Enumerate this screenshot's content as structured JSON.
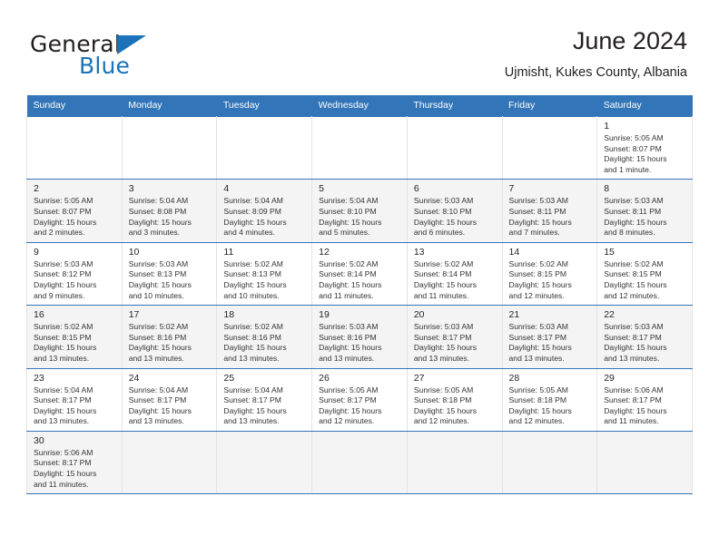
{
  "brand": {
    "name_part1": "General",
    "name_part2": "Blue",
    "flag_icon": "triangle-flag-icon"
  },
  "header": {
    "title": "June 2024",
    "subtitle": "Ujmisht, Kukes County, Albania"
  },
  "calendar": {
    "weekday_headers": [
      "Sunday",
      "Monday",
      "Tuesday",
      "Wednesday",
      "Thursday",
      "Friday",
      "Saturday"
    ],
    "accent_color": "#3275b9",
    "header_text_color": "#ffffff",
    "shaded_row_color": "#f4f4f4",
    "weeks": [
      {
        "shaded": false,
        "days": [
          {
            "day": "",
            "sunrise": "",
            "sunset": "",
            "daylight": "",
            "daylight2": "",
            "empty": true
          },
          {
            "day": "",
            "sunrise": "",
            "sunset": "",
            "daylight": "",
            "daylight2": "",
            "empty": true
          },
          {
            "day": "",
            "sunrise": "",
            "sunset": "",
            "daylight": "",
            "daylight2": "",
            "empty": true
          },
          {
            "day": "",
            "sunrise": "",
            "sunset": "",
            "daylight": "",
            "daylight2": "",
            "empty": true
          },
          {
            "day": "",
            "sunrise": "",
            "sunset": "",
            "daylight": "",
            "daylight2": "",
            "empty": true
          },
          {
            "day": "",
            "sunrise": "",
            "sunset": "",
            "daylight": "",
            "daylight2": "",
            "empty": true
          },
          {
            "day": "1",
            "sunrise": "Sunrise: 5:05 AM",
            "sunset": "Sunset: 8:07 PM",
            "daylight": "Daylight: 15 hours",
            "daylight2": "and 1 minute.",
            "empty": false
          }
        ]
      },
      {
        "shaded": true,
        "days": [
          {
            "day": "2",
            "sunrise": "Sunrise: 5:05 AM",
            "sunset": "Sunset: 8:07 PM",
            "daylight": "Daylight: 15 hours",
            "daylight2": "and 2 minutes.",
            "empty": false
          },
          {
            "day": "3",
            "sunrise": "Sunrise: 5:04 AM",
            "sunset": "Sunset: 8:08 PM",
            "daylight": "Daylight: 15 hours",
            "daylight2": "and 3 minutes.",
            "empty": false
          },
          {
            "day": "4",
            "sunrise": "Sunrise: 5:04 AM",
            "sunset": "Sunset: 8:09 PM",
            "daylight": "Daylight: 15 hours",
            "daylight2": "and 4 minutes.",
            "empty": false
          },
          {
            "day": "5",
            "sunrise": "Sunrise: 5:04 AM",
            "sunset": "Sunset: 8:10 PM",
            "daylight": "Daylight: 15 hours",
            "daylight2": "and 5 minutes.",
            "empty": false
          },
          {
            "day": "6",
            "sunrise": "Sunrise: 5:03 AM",
            "sunset": "Sunset: 8:10 PM",
            "daylight": "Daylight: 15 hours",
            "daylight2": "and 6 minutes.",
            "empty": false
          },
          {
            "day": "7",
            "sunrise": "Sunrise: 5:03 AM",
            "sunset": "Sunset: 8:11 PM",
            "daylight": "Daylight: 15 hours",
            "daylight2": "and 7 minutes.",
            "empty": false
          },
          {
            "day": "8",
            "sunrise": "Sunrise: 5:03 AM",
            "sunset": "Sunset: 8:11 PM",
            "daylight": "Daylight: 15 hours",
            "daylight2": "and 8 minutes.",
            "empty": false
          }
        ]
      },
      {
        "shaded": false,
        "days": [
          {
            "day": "9",
            "sunrise": "Sunrise: 5:03 AM",
            "sunset": "Sunset: 8:12 PM",
            "daylight": "Daylight: 15 hours",
            "daylight2": "and 9 minutes.",
            "empty": false
          },
          {
            "day": "10",
            "sunrise": "Sunrise: 5:03 AM",
            "sunset": "Sunset: 8:13 PM",
            "daylight": "Daylight: 15 hours",
            "daylight2": "and 10 minutes.",
            "empty": false
          },
          {
            "day": "11",
            "sunrise": "Sunrise: 5:02 AM",
            "sunset": "Sunset: 8:13 PM",
            "daylight": "Daylight: 15 hours",
            "daylight2": "and 10 minutes.",
            "empty": false
          },
          {
            "day": "12",
            "sunrise": "Sunrise: 5:02 AM",
            "sunset": "Sunset: 8:14 PM",
            "daylight": "Daylight: 15 hours",
            "daylight2": "and 11 minutes.",
            "empty": false
          },
          {
            "day": "13",
            "sunrise": "Sunrise: 5:02 AM",
            "sunset": "Sunset: 8:14 PM",
            "daylight": "Daylight: 15 hours",
            "daylight2": "and 11 minutes.",
            "empty": false
          },
          {
            "day": "14",
            "sunrise": "Sunrise: 5:02 AM",
            "sunset": "Sunset: 8:15 PM",
            "daylight": "Daylight: 15 hours",
            "daylight2": "and 12 minutes.",
            "empty": false
          },
          {
            "day": "15",
            "sunrise": "Sunrise: 5:02 AM",
            "sunset": "Sunset: 8:15 PM",
            "daylight": "Daylight: 15 hours",
            "daylight2": "and 12 minutes.",
            "empty": false
          }
        ]
      },
      {
        "shaded": true,
        "days": [
          {
            "day": "16",
            "sunrise": "Sunrise: 5:02 AM",
            "sunset": "Sunset: 8:15 PM",
            "daylight": "Daylight: 15 hours",
            "daylight2": "and 13 minutes.",
            "empty": false
          },
          {
            "day": "17",
            "sunrise": "Sunrise: 5:02 AM",
            "sunset": "Sunset: 8:16 PM",
            "daylight": "Daylight: 15 hours",
            "daylight2": "and 13 minutes.",
            "empty": false
          },
          {
            "day": "18",
            "sunrise": "Sunrise: 5:02 AM",
            "sunset": "Sunset: 8:16 PM",
            "daylight": "Daylight: 15 hours",
            "daylight2": "and 13 minutes.",
            "empty": false
          },
          {
            "day": "19",
            "sunrise": "Sunrise: 5:03 AM",
            "sunset": "Sunset: 8:16 PM",
            "daylight": "Daylight: 15 hours",
            "daylight2": "and 13 minutes.",
            "empty": false
          },
          {
            "day": "20",
            "sunrise": "Sunrise: 5:03 AM",
            "sunset": "Sunset: 8:17 PM",
            "daylight": "Daylight: 15 hours",
            "daylight2": "and 13 minutes.",
            "empty": false
          },
          {
            "day": "21",
            "sunrise": "Sunrise: 5:03 AM",
            "sunset": "Sunset: 8:17 PM",
            "daylight": "Daylight: 15 hours",
            "daylight2": "and 13 minutes.",
            "empty": false
          },
          {
            "day": "22",
            "sunrise": "Sunrise: 5:03 AM",
            "sunset": "Sunset: 8:17 PM",
            "daylight": "Daylight: 15 hours",
            "daylight2": "and 13 minutes.",
            "empty": false
          }
        ]
      },
      {
        "shaded": false,
        "days": [
          {
            "day": "23",
            "sunrise": "Sunrise: 5:04 AM",
            "sunset": "Sunset: 8:17 PM",
            "daylight": "Daylight: 15 hours",
            "daylight2": "and 13 minutes.",
            "empty": false
          },
          {
            "day": "24",
            "sunrise": "Sunrise: 5:04 AM",
            "sunset": "Sunset: 8:17 PM",
            "daylight": "Daylight: 15 hours",
            "daylight2": "and 13 minutes.",
            "empty": false
          },
          {
            "day": "25",
            "sunrise": "Sunrise: 5:04 AM",
            "sunset": "Sunset: 8:17 PM",
            "daylight": "Daylight: 15 hours",
            "daylight2": "and 13 minutes.",
            "empty": false
          },
          {
            "day": "26",
            "sunrise": "Sunrise: 5:05 AM",
            "sunset": "Sunset: 8:17 PM",
            "daylight": "Daylight: 15 hours",
            "daylight2": "and 12 minutes.",
            "empty": false
          },
          {
            "day": "27",
            "sunrise": "Sunrise: 5:05 AM",
            "sunset": "Sunset: 8:18 PM",
            "daylight": "Daylight: 15 hours",
            "daylight2": "and 12 minutes.",
            "empty": false
          },
          {
            "day": "28",
            "sunrise": "Sunrise: 5:05 AM",
            "sunset": "Sunset: 8:18 PM",
            "daylight": "Daylight: 15 hours",
            "daylight2": "and 12 minutes.",
            "empty": false
          },
          {
            "day": "29",
            "sunrise": "Sunrise: 5:06 AM",
            "sunset": "Sunset: 8:17 PM",
            "daylight": "Daylight: 15 hours",
            "daylight2": "and 11 minutes.",
            "empty": false
          }
        ]
      },
      {
        "shaded": true,
        "days": [
          {
            "day": "30",
            "sunrise": "Sunrise: 5:06 AM",
            "sunset": "Sunset: 8:17 PM",
            "daylight": "Daylight: 15 hours",
            "daylight2": "and 11 minutes.",
            "empty": false
          },
          {
            "day": "",
            "sunrise": "",
            "sunset": "",
            "daylight": "",
            "daylight2": "",
            "empty": true
          },
          {
            "day": "",
            "sunrise": "",
            "sunset": "",
            "daylight": "",
            "daylight2": "",
            "empty": true
          },
          {
            "day": "",
            "sunrise": "",
            "sunset": "",
            "daylight": "",
            "daylight2": "",
            "empty": true
          },
          {
            "day": "",
            "sunrise": "",
            "sunset": "",
            "daylight": "",
            "daylight2": "",
            "empty": true
          },
          {
            "day": "",
            "sunrise": "",
            "sunset": "",
            "daylight": "",
            "daylight2": "",
            "empty": true
          },
          {
            "day": "",
            "sunrise": "",
            "sunset": "",
            "daylight": "",
            "daylight2": "",
            "empty": true
          }
        ]
      }
    ]
  }
}
